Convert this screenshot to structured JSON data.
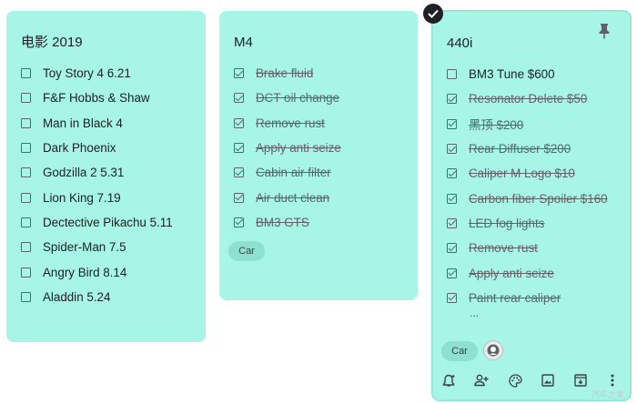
{
  "notes": [
    {
      "title": "电影 2019",
      "items": [
        {
          "text": "Toy Story 4 6.21",
          "checked": false
        },
        {
          "text": "F&F Hobbs & Shaw",
          "checked": false
        },
        {
          "text": "Man in Black  4",
          "checked": false
        },
        {
          "text": "Dark Phoenix",
          "checked": false
        },
        {
          "text": "Godzilla 2 5.31",
          "checked": false
        },
        {
          "text": "Lion King 7.19",
          "checked": false
        },
        {
          "text": "Dectective Pikachu 5.11",
          "checked": false
        },
        {
          "text": "Spider-Man 7.5",
          "checked": false
        },
        {
          "text": "Angry Bird 8.14",
          "checked": false
        },
        {
          "text": "Aladdin 5.24",
          "checked": false
        }
      ]
    },
    {
      "title": "M4",
      "items": [
        {
          "text": "Brake fluid",
          "checked": true
        },
        {
          "text": "DCT oil change",
          "checked": true
        },
        {
          "text": "Remove rust",
          "checked": true
        },
        {
          "text": "Apply anti seize",
          "checked": true
        },
        {
          "text": "Cabin air filter",
          "checked": true
        },
        {
          "text": "Air duct clean",
          "checked": true
        },
        {
          "text": "BM3 GTS",
          "checked": true
        }
      ],
      "label": "Car"
    },
    {
      "title": "440i",
      "items": [
        {
          "text": "BM3 Tune $600",
          "checked": false
        },
        {
          "text": "Resonator Delete $50",
          "checked": true
        },
        {
          "text": "黑顶 $200",
          "checked": true
        },
        {
          "text": "Rear Diffuser $200",
          "checked": true
        },
        {
          "text": "Caliper M Logo $10",
          "checked": true
        },
        {
          "text": "Carbon fiber Spoiler $160",
          "checked": true
        },
        {
          "text": "LED fog lights",
          "checked": true
        },
        {
          "text": "Remove rust",
          "checked": true
        },
        {
          "text": "Apply anti seize",
          "checked": true
        },
        {
          "text": "Paint rear caliper",
          "checked": true
        }
      ],
      "more": "...",
      "label": "Car",
      "pinned": true
    }
  ],
  "toolbar": [
    "reminder-icon",
    "collaborator-icon",
    "palette-icon",
    "image-icon",
    "archive-icon",
    "more-icon"
  ],
  "watermark": "汽车之家",
  "colors": {
    "card": "#a7f5e6",
    "chip": "#8fe1cf",
    "text": "#202124",
    "muted": "#5f6368"
  }
}
